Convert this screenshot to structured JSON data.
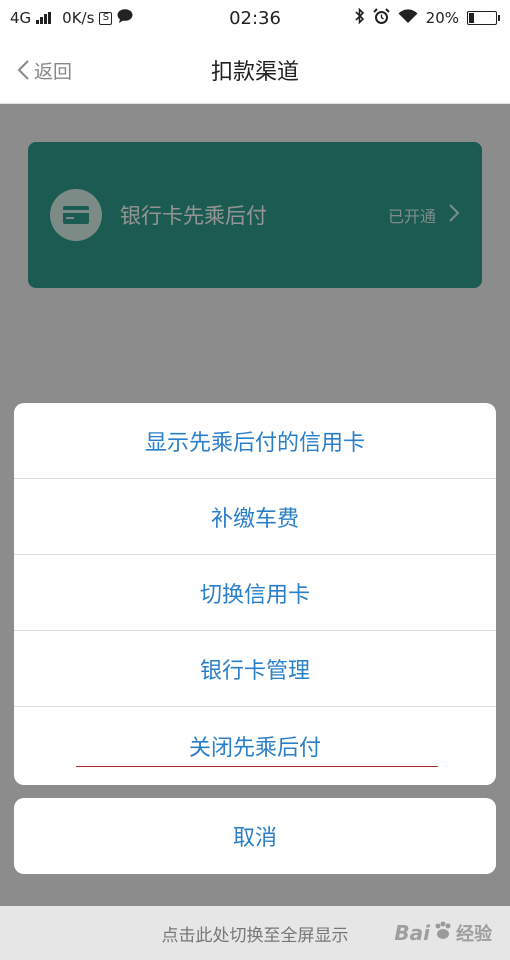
{
  "status_bar": {
    "network": "4G",
    "speed": "0K/s",
    "s_badge": "S",
    "time": "02:36",
    "battery": "20%",
    "battery_level": 0.2,
    "icons": [
      "signal-icon",
      "s-badge-icon",
      "message-bubble-icon",
      "bluetooth-icon",
      "alarm-icon",
      "wifi-icon",
      "battery-icon"
    ]
  },
  "nav": {
    "back_label": "返回",
    "title": "扣款渠道"
  },
  "card": {
    "title": "银行卡先乘后付",
    "status": "已开通",
    "color": "#2f9e8d",
    "icon": "bank-card-icon"
  },
  "action_sheet": {
    "items": [
      {
        "label": "显示先乘后付的信用卡"
      },
      {
        "label": "补缴车费"
      },
      {
        "label": "切换信用卡"
      },
      {
        "label": "银行卡管理"
      },
      {
        "label": "关闭先乘后付"
      }
    ],
    "cancel_label": "取消",
    "accent": "#2a7fc9"
  },
  "bottom_bar": {
    "label": "点击此处切换至全屏显示"
  },
  "watermark": {
    "text_left": "Bai",
    "text_right": "经验"
  }
}
